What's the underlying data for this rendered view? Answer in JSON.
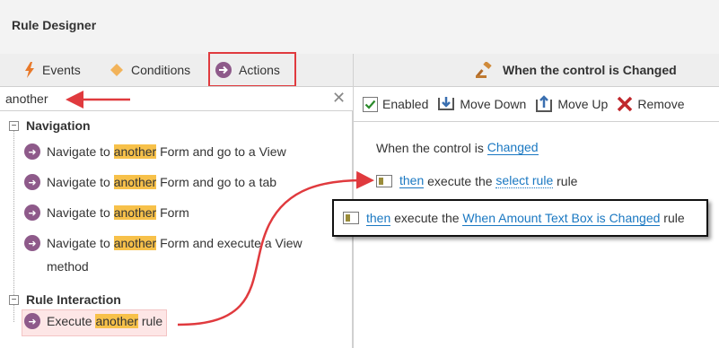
{
  "app": {
    "title": "Rule Designer"
  },
  "tabs": [
    {
      "label": "Events",
      "icon": "lightning-icon"
    },
    {
      "label": "Conditions",
      "icon": "diamond-icon"
    },
    {
      "label": "Actions",
      "icon": "arrow-circle-icon"
    }
  ],
  "search": {
    "value": "another",
    "placeholder": ""
  },
  "tree": {
    "groups": [
      {
        "label": "Navigation",
        "expander": "−"
      },
      {
        "label": "Rule Interaction",
        "expander": "−"
      }
    ],
    "items": [
      {
        "pre": "Navigate to ",
        "hl": "another",
        "post": " Form and go to a View"
      },
      {
        "pre": "Navigate to ",
        "hl": "another",
        "post": " Form and go to a tab"
      },
      {
        "pre": "Navigate to ",
        "hl": "another",
        "post": " Form"
      },
      {
        "pre": "Navigate to ",
        "hl": "another",
        "post": " Form and execute a View",
        "post2": "method"
      },
      {
        "pre": "Execute ",
        "hl": "another",
        "post": " rule"
      }
    ]
  },
  "right": {
    "header": "When the control is Changed",
    "toolbar": {
      "enabled": "Enabled",
      "move_down": "Move Down",
      "move_up": "Move Up",
      "remove": "Remove"
    },
    "rule1": {
      "text": "When the control is ",
      "link": "Changed"
    },
    "rule2": {
      "then": "then",
      "mid": " execute the ",
      "link": "select rule",
      "post": " rule"
    },
    "callout": {
      "then": "then",
      "mid": " execute the ",
      "link": "When Amount Text Box is Changed",
      "post": " rule"
    }
  },
  "colors": {
    "annotation": "#e03a3e",
    "highlight": "#f7c14a",
    "link": "#1a78c2",
    "action_icon": "#8e5a8a"
  }
}
